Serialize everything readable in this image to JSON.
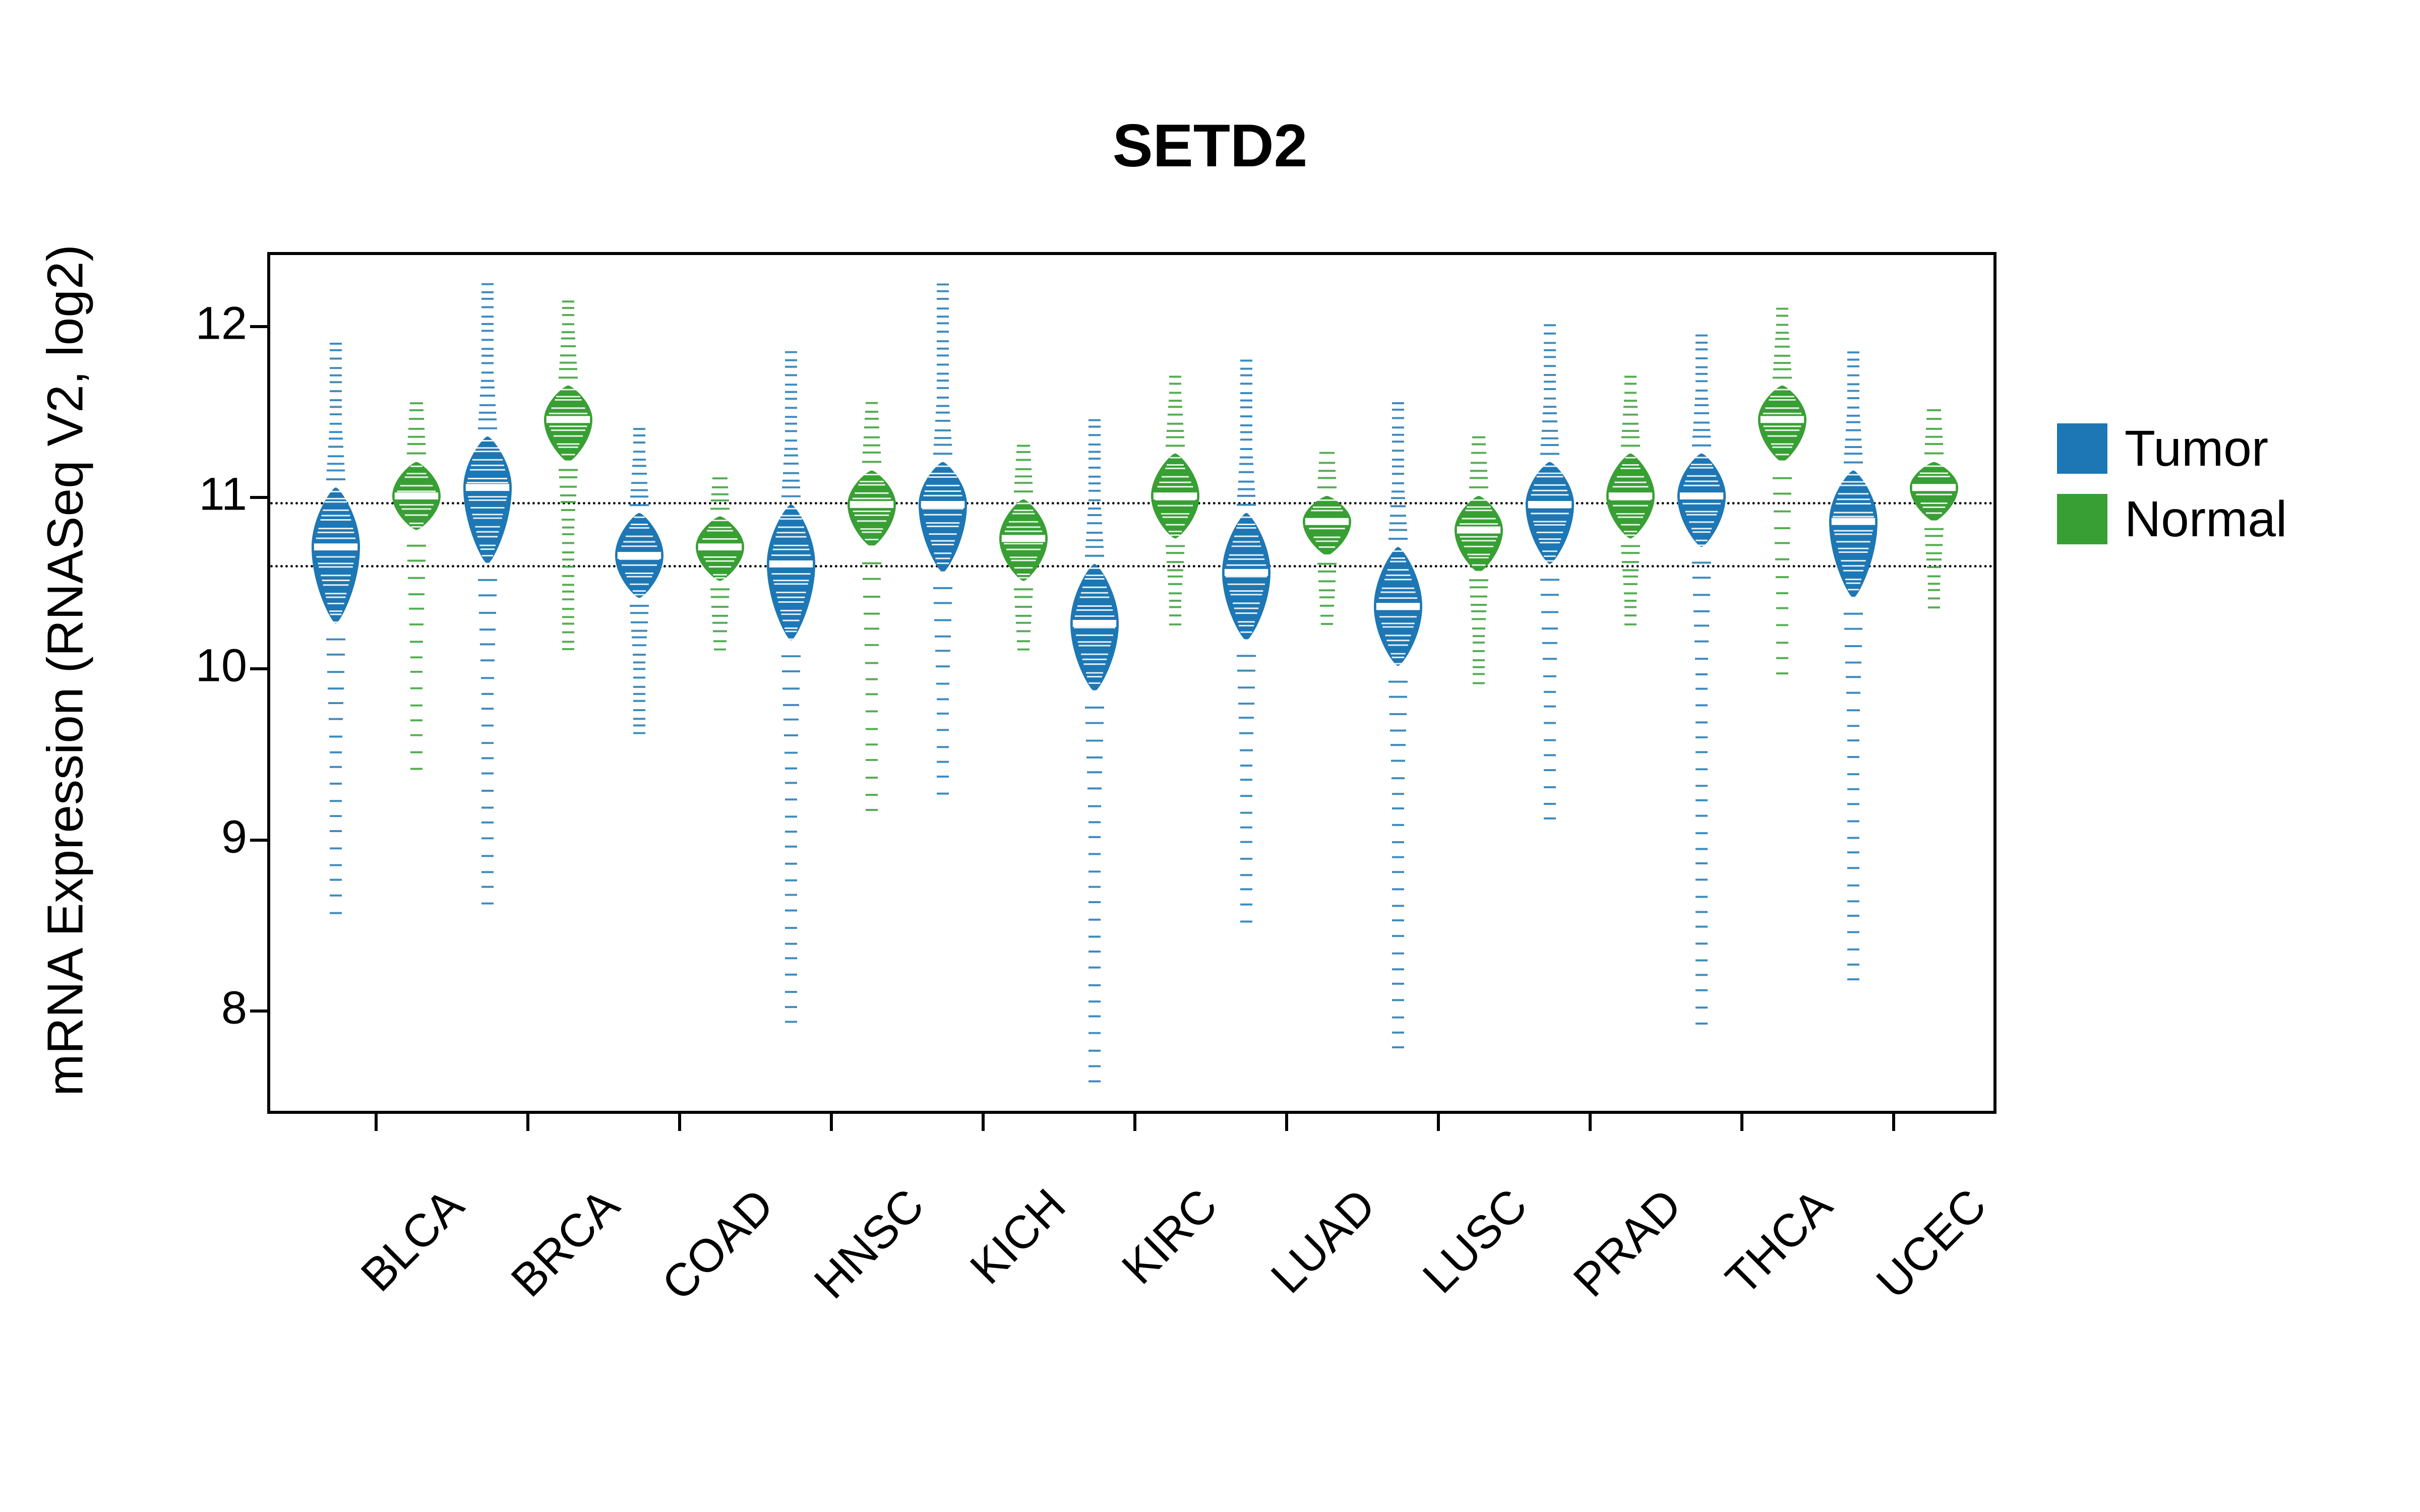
{
  "chart_data": {
    "type": "violin",
    "title": "SETD2",
    "ylabel": "mRNA Expression (RNASeq V2, log2)",
    "xlabel": "",
    "ylim": [
      7.4,
      12.4
    ],
    "yticks": [
      8,
      9,
      10,
      11,
      12
    ],
    "reference_lines": [
      10.6,
      10.97
    ],
    "categories": [
      "BLCA",
      "BRCA",
      "COAD",
      "HNSC",
      "KICH",
      "KIRC",
      "LUAD",
      "LUSC",
      "PRAD",
      "THCA",
      "UCEC"
    ],
    "series": [
      {
        "name": "Tumor",
        "color": "#1d77b4"
      },
      {
        "name": "Normal",
        "color": "#389f34"
      }
    ],
    "per_category": {
      "BLCA": {
        "Tumor": {
          "median": 10.7,
          "q1": 10.25,
          "q3": 11.05,
          "lo": 8.55,
          "hi": 11.9
        },
        "Normal": {
          "median": 11.0,
          "q1": 10.8,
          "q3": 11.2,
          "lo": 9.4,
          "hi": 11.55
        }
      },
      "BRCA": {
        "Tumor": {
          "median": 11.05,
          "q1": 10.6,
          "q3": 11.35,
          "lo": 8.6,
          "hi": 12.25
        },
        "Normal": {
          "median": 11.45,
          "q1": 11.2,
          "q3": 11.65,
          "lo": 10.1,
          "hi": 12.15
        }
      },
      "COAD": {
        "Tumor": {
          "median": 10.65,
          "q1": 10.4,
          "q3": 10.9,
          "lo": 9.6,
          "hi": 11.4
        },
        "Normal": {
          "median": 10.7,
          "q1": 10.5,
          "q3": 10.88,
          "lo": 10.1,
          "hi": 11.1
        }
      },
      "HNSC": {
        "Tumor": {
          "median": 10.6,
          "q1": 10.15,
          "q3": 10.95,
          "lo": 7.9,
          "hi": 11.85
        },
        "Normal": {
          "median": 10.95,
          "q1": 10.7,
          "q3": 11.15,
          "lo": 9.15,
          "hi": 11.55
        }
      },
      "KICH": {
        "Tumor": {
          "median": 10.95,
          "q1": 10.55,
          "q3": 11.2,
          "lo": 9.25,
          "hi": 12.25
        },
        "Normal": {
          "median": 10.75,
          "q1": 10.5,
          "q3": 10.98,
          "lo": 10.1,
          "hi": 11.3
        }
      },
      "KIRC": {
        "Tumor": {
          "median": 10.25,
          "q1": 9.85,
          "q3": 10.6,
          "lo": 7.55,
          "hi": 11.45
        },
        "Normal": {
          "median": 11.0,
          "q1": 10.75,
          "q3": 11.25,
          "lo": 10.25,
          "hi": 11.7
        }
      },
      "LUAD": {
        "Tumor": {
          "median": 10.55,
          "q1": 10.15,
          "q3": 10.9,
          "lo": 8.5,
          "hi": 11.8
        },
        "Normal": {
          "median": 10.85,
          "q1": 10.65,
          "q3": 11.0,
          "lo": 10.25,
          "hi": 11.25
        }
      },
      "LUSC": {
        "Tumor": {
          "median": 10.35,
          "q1": 10.0,
          "q3": 10.7,
          "lo": 7.75,
          "hi": 11.55
        },
        "Normal": {
          "median": 10.8,
          "q1": 10.55,
          "q3": 11.0,
          "lo": 9.9,
          "hi": 11.35
        }
      },
      "PRAD": {
        "Tumor": {
          "median": 10.95,
          "q1": 10.6,
          "q3": 11.2,
          "lo": 9.1,
          "hi": 12.0
        },
        "Normal": {
          "median": 11.0,
          "q1": 10.75,
          "q3": 11.25,
          "lo": 10.25,
          "hi": 11.7
        }
      },
      "THCA": {
        "Tumor": {
          "median": 11.0,
          "q1": 10.7,
          "q3": 11.25,
          "lo": 7.9,
          "hi": 11.95
        },
        "Normal": {
          "median": 11.45,
          "q1": 11.2,
          "q3": 11.65,
          "lo": 9.95,
          "hi": 12.1
        }
      },
      "UCEC": {
        "Tumor": {
          "median": 10.85,
          "q1": 10.4,
          "q3": 11.15,
          "lo": 8.15,
          "hi": 11.85
        },
        "Normal": {
          "median": 11.05,
          "q1": 10.85,
          "q3": 11.2,
          "lo": 10.35,
          "hi": 11.5
        }
      }
    }
  },
  "legend": {
    "items": [
      {
        "label": "Tumor",
        "key": "tumor"
      },
      {
        "label": "Normal",
        "key": "normal"
      }
    ]
  }
}
